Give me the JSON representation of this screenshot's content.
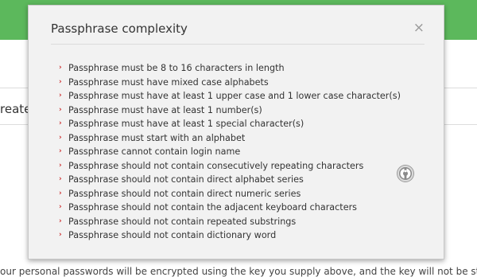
{
  "background": {
    "heading_fragment": "reate",
    "footer_fragment": "our personal passwords will be encrypted using the key you supply above, and the key will not be stored a"
  },
  "modal": {
    "title": "Passphrase complexity",
    "close_label": "×",
    "rules": [
      "Passphrase must be 8 to 16 characters in length",
      "Passphrase must have mixed case alphabets",
      "Passphrase must have at least 1 upper case and 1 lower case character(s)",
      "Passphrase must have at least 1 number(s)",
      "Passphrase must have at least 1 special character(s)",
      "Passphrase must start with an alphabet",
      "Passphrase cannot contain login name",
      "Passphrase should not contain consecutively repeating characters",
      "Passphrase should not contain direct alphabet series",
      "Passphrase should not contain direct numeric series",
      "Passphrase should not contain the adjacent keyboard characters",
      "Passphrase should not contain repeated substrings",
      "Passphrase should not contain dictionary word"
    ],
    "help_icon": "help-lifebuoy-icon"
  },
  "colors": {
    "top_bar": "#5cb85c",
    "bullet": "#cc2b2b",
    "modal_bg": "#f2f2f2"
  }
}
